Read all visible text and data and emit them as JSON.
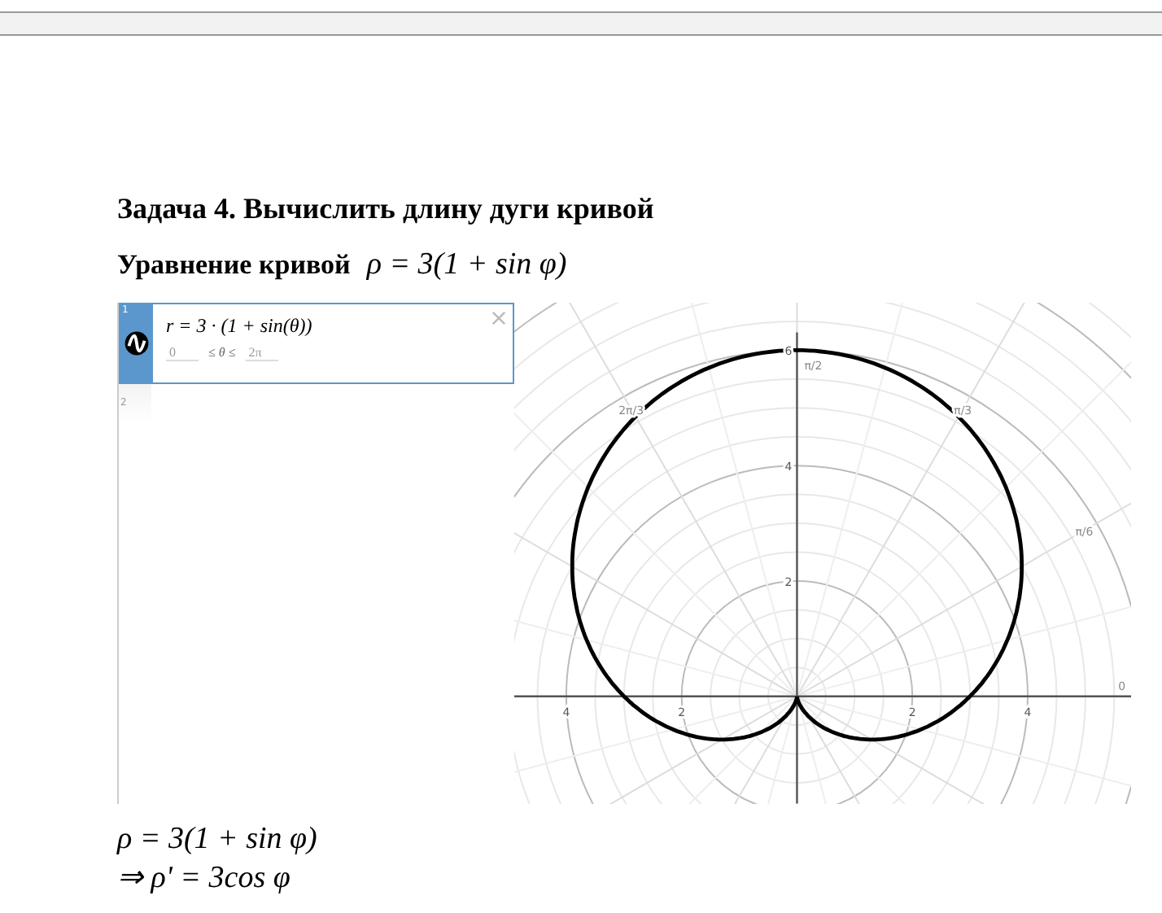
{
  "title": "Задача 4. Вычислить длину дуги кривой",
  "equation_line": {
    "label": "Уравнение кривой",
    "formula": "ρ = 3(1 + sin φ)"
  },
  "grapher": {
    "expressions": [
      {
        "number": "1",
        "formula": "r = 3 · (1 + sin(θ))",
        "domain_min": "0",
        "domain_relation": "≤ θ ≤",
        "domain_max": "2π",
        "selected": true,
        "kind": "expression"
      },
      {
        "number": "2",
        "selected": false,
        "kind": "empty"
      }
    ],
    "x_tick_labels": [
      "4",
      "2",
      "2",
      "4"
    ],
    "y_tick_labels": [
      "6",
      "4",
      "2"
    ],
    "angle_labels": [
      "0",
      "π/6",
      "π/3",
      "π/2",
      "2π/3"
    ]
  },
  "solution_lines": [
    "ρ = 3(1 + sin φ)",
    "⇒ ρ' = 3cos φ"
  ]
}
